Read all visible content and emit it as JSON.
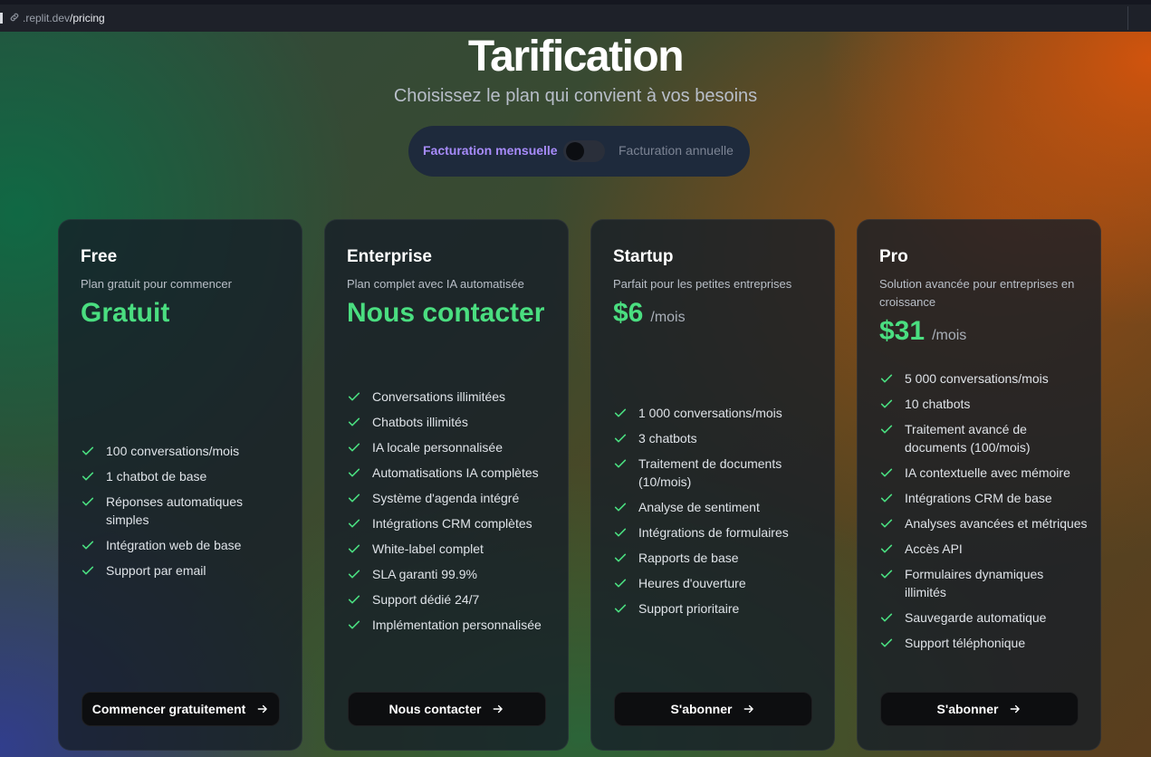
{
  "browser": {
    "url_host": ".replit.dev",
    "url_path": "/pricing"
  },
  "page": {
    "title": "Tarification",
    "subtitle": "Choisissez le plan qui convient à vos besoins"
  },
  "billing_toggle": {
    "monthly_label": "Facturation mensuelle",
    "annual_label": "Facturation annuelle",
    "annual_selected": false
  },
  "colors": {
    "accent_price": "#4ade80",
    "accent_toggle": "#a78bfa",
    "check": "#4ade80"
  },
  "plans": [
    {
      "name": "Free",
      "description": "Plan gratuit pour commencer",
      "price": "Gratuit",
      "period": "",
      "features": [
        "100 conversations/mois",
        "1 chatbot de base",
        "Réponses automatiques simples",
        "Intégration web de base",
        "Support par email"
      ],
      "cta": "Commencer gratuitement"
    },
    {
      "name": "Enterprise",
      "description": "Plan complet avec IA automatisée",
      "price": "Nous contacter",
      "period": "",
      "features": [
        "Conversations illimitées",
        "Chatbots illimités",
        "IA locale personnalisée",
        "Automatisations IA complètes",
        "Système d'agenda intégré",
        "Intégrations CRM complètes",
        "White-label complet",
        "SLA garanti 99.9%",
        "Support dédié 24/7",
        "Implémentation personnalisée"
      ],
      "cta": "Nous contacter"
    },
    {
      "name": "Startup",
      "description": "Parfait pour les petites entreprises",
      "price": "$6",
      "period": "/mois",
      "features": [
        "1 000 conversations/mois",
        "3 chatbots",
        "Traitement de documents (10/mois)",
        "Analyse de sentiment",
        "Intégrations de formulaires",
        "Rapports de base",
        "Heures d'ouverture",
        "Support prioritaire"
      ],
      "cta": "S'abonner"
    },
    {
      "name": "Pro",
      "description": "Solution avancée pour entreprises en croissance",
      "price": "$31",
      "period": "/mois",
      "features": [
        "5 000 conversations/mois",
        "10 chatbots",
        "Traitement avancé de documents (100/mois)",
        "IA contextuelle avec mémoire",
        "Intégrations CRM de base",
        "Analyses avancées et métriques",
        "Accès API",
        "Formulaires dynamiques illimités",
        "Sauvegarde automatique",
        "Support téléphonique"
      ],
      "cta": "S'abonner"
    }
  ]
}
